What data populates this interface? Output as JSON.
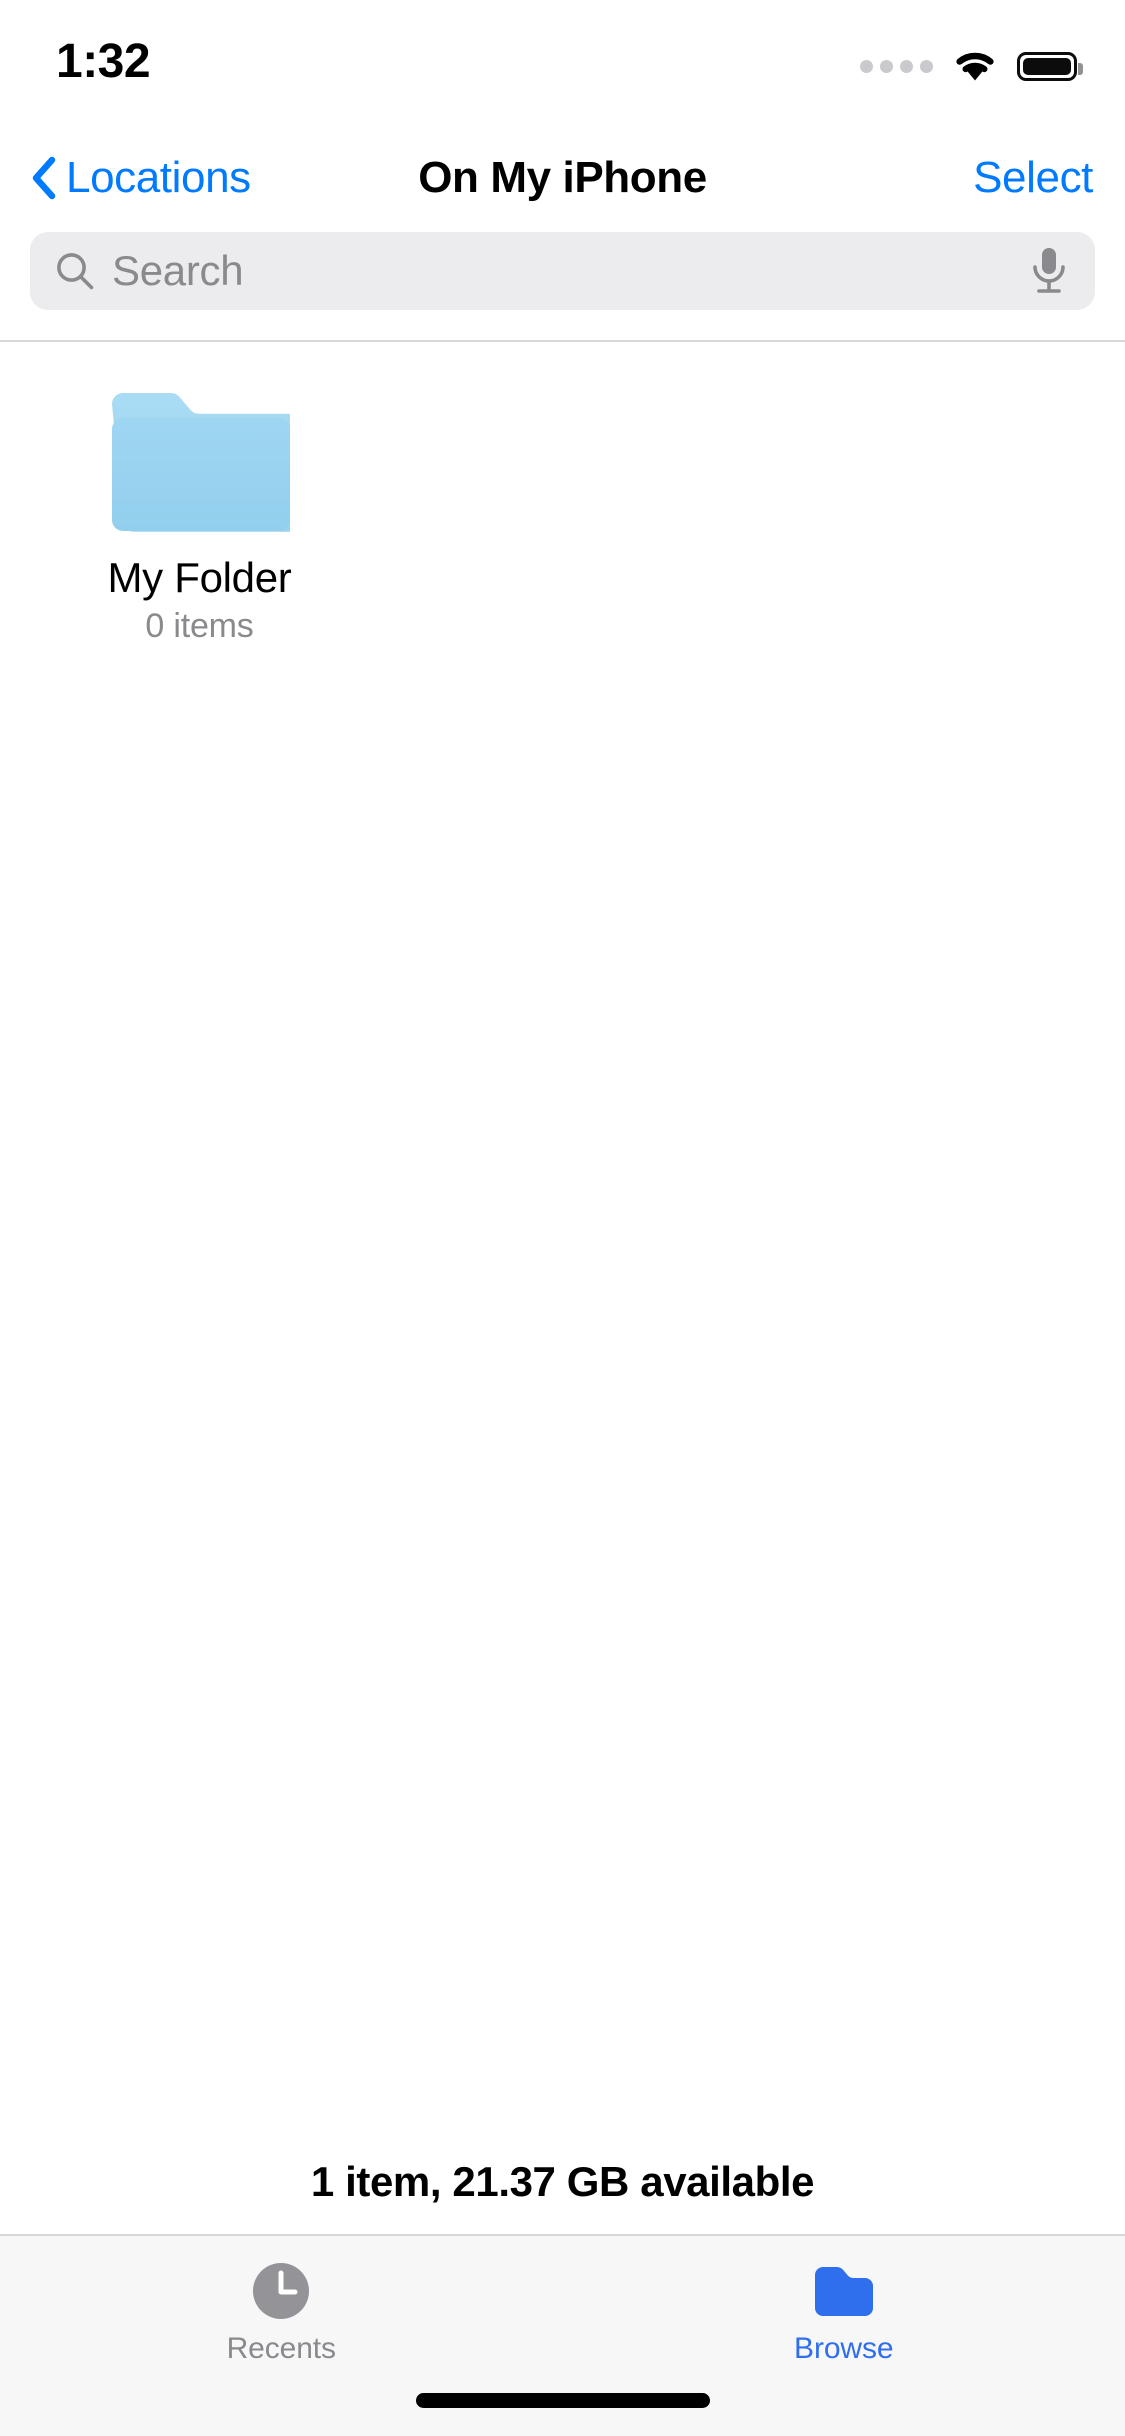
{
  "status_bar": {
    "time": "1:32",
    "cellular_icon": "cellular-dots-icon",
    "cellular_dots": 4,
    "wifi_icon": "wifi-icon",
    "battery_icon": "battery-full-icon"
  },
  "nav_bar": {
    "back_label": "Locations",
    "back_icon": "chevron-left-icon",
    "title": "On My iPhone",
    "select_label": "Select"
  },
  "search": {
    "placeholder": "Search",
    "value": "",
    "search_icon": "search-icon",
    "mic_icon": "microphone-icon"
  },
  "content": {
    "items": [
      {
        "name": "My Folder",
        "subtitle": "0 items",
        "icon": "folder-icon",
        "icon_color": "#9ed5f0"
      }
    ],
    "status_text": "1 item, 21.37 GB available"
  },
  "tab_bar": {
    "tabs": [
      {
        "label": "Recents",
        "icon": "clock-icon",
        "active": false
      },
      {
        "label": "Browse",
        "icon": "folder-icon",
        "active": true
      }
    ]
  },
  "colors": {
    "accent": "#007aff",
    "tab_active": "#2f6fed",
    "tab_inactive": "#8a8a8e",
    "search_bg": "#ececee",
    "folder_light": "#9ed5f0",
    "tab_bar_bg": "#f7f7f8"
  }
}
